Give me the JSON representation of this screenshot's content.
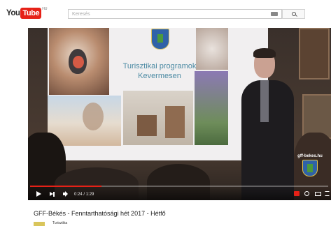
{
  "header": {
    "logo": {
      "you": "You",
      "tube": "Tube",
      "region": "HU"
    },
    "search": {
      "placeholder": "Keresés"
    }
  },
  "video": {
    "slide_title_line1": "Turisztikai programok",
    "slide_title_line2": "Kevermesen",
    "watermark_text": "gff-bekes.hu",
    "progress_fraction": 0.24,
    "time": {
      "current": "0:24",
      "separator": " / ",
      "duration": "1:29"
    },
    "colors": {
      "progress": "#e62117",
      "slide_title": "#4d8ba4"
    }
  },
  "info": {
    "title": "GFF-Békés - Fenntarthatósági hét 2017 - Hétfő",
    "channel": "Turisztika"
  }
}
